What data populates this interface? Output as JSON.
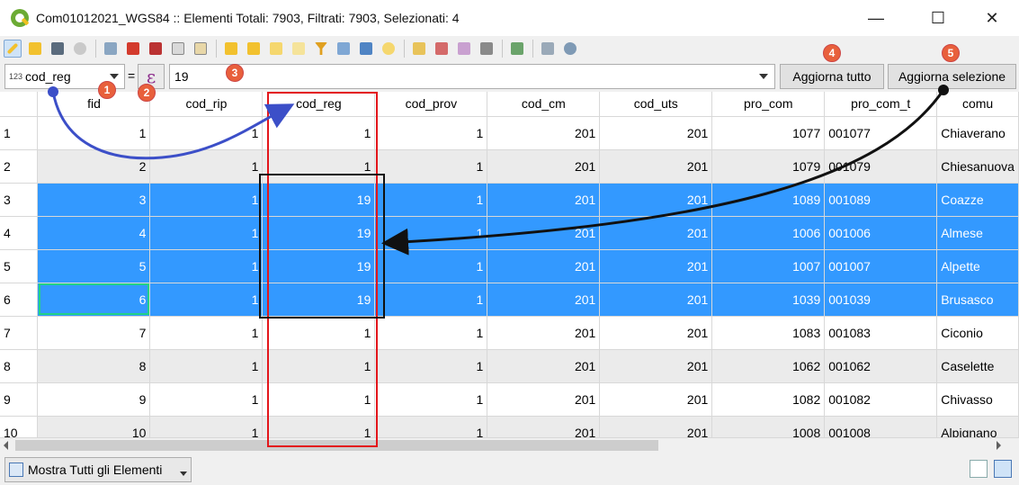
{
  "window": {
    "title": "Com01012021_WGS84 :: Elementi Totali: 7903, Filtrati: 7903, Selezionati: 4",
    "minimize": "—",
    "maximize": "☐",
    "close": "✕"
  },
  "filter": {
    "field_type": "123",
    "field": "cod_reg",
    "equals": "=",
    "expr_symbol": "ε",
    "value": "19",
    "update_all": "Aggiorna tutto",
    "update_selection": "Aggiorna selezione"
  },
  "columns": [
    "fid",
    "cod_rip",
    "cod_reg",
    "cod_prov",
    "cod_cm",
    "cod_uts",
    "pro_com",
    "pro_com_t",
    "comu"
  ],
  "rows": [
    {
      "n": "1",
      "fid": "1",
      "cod_rip": "1",
      "cod_reg": "1",
      "cod_prov": "1",
      "cod_cm": "201",
      "cod_uts": "201",
      "pro_com": "1077",
      "pro_com_t": "001077",
      "comu": "Chiaverano"
    },
    {
      "n": "2",
      "fid": "2",
      "cod_rip": "1",
      "cod_reg": "1",
      "cod_prov": "1",
      "cod_cm": "201",
      "cod_uts": "201",
      "pro_com": "1079",
      "pro_com_t": "001079",
      "comu": "Chiesanuova"
    },
    {
      "n": "3",
      "fid": "3",
      "cod_rip": "1",
      "cod_reg": "19",
      "cod_prov": "1",
      "cod_cm": "201",
      "cod_uts": "201",
      "pro_com": "1089",
      "pro_com_t": "001089",
      "comu": "Coazze"
    },
    {
      "n": "4",
      "fid": "4",
      "cod_rip": "1",
      "cod_reg": "19",
      "cod_prov": "1",
      "cod_cm": "201",
      "cod_uts": "201",
      "pro_com": "1006",
      "pro_com_t": "001006",
      "comu": "Almese"
    },
    {
      "n": "5",
      "fid": "5",
      "cod_rip": "1",
      "cod_reg": "19",
      "cod_prov": "1",
      "cod_cm": "201",
      "cod_uts": "201",
      "pro_com": "1007",
      "pro_com_t": "001007",
      "comu": "Alpette"
    },
    {
      "n": "6",
      "fid": "6",
      "cod_rip": "1",
      "cod_reg": "19",
      "cod_prov": "1",
      "cod_cm": "201",
      "cod_uts": "201",
      "pro_com": "1039",
      "pro_com_t": "001039",
      "comu": "Brusasco"
    },
    {
      "n": "7",
      "fid": "7",
      "cod_rip": "1",
      "cod_reg": "1",
      "cod_prov": "1",
      "cod_cm": "201",
      "cod_uts": "201",
      "pro_com": "1083",
      "pro_com_t": "001083",
      "comu": "Ciconio"
    },
    {
      "n": "8",
      "fid": "8",
      "cod_rip": "1",
      "cod_reg": "1",
      "cod_prov": "1",
      "cod_cm": "201",
      "cod_uts": "201",
      "pro_com": "1062",
      "pro_com_t": "001062",
      "comu": "Caselette"
    },
    {
      "n": "9",
      "fid": "9",
      "cod_rip": "1",
      "cod_reg": "1",
      "cod_prov": "1",
      "cod_cm": "201",
      "cod_uts": "201",
      "pro_com": "1082",
      "pro_com_t": "001082",
      "comu": "Chivasso"
    },
    {
      "n": "10",
      "fid": "10",
      "cod_rip": "1",
      "cod_reg": "1",
      "cod_prov": "1",
      "cod_cm": "201",
      "cod_uts": "201",
      "pro_com": "1008",
      "pro_com_t": "001008",
      "comu": "Alpignano"
    }
  ],
  "selected_rows": [
    "3",
    "4",
    "5",
    "6"
  ],
  "bottom": {
    "show_all": "Mostra Tutti gli Elementi"
  },
  "badges": [
    "1",
    "2",
    "3",
    "4",
    "5"
  ],
  "colors": {
    "selection": "#3399ff",
    "badge": "#e8603c",
    "blue_arrow": "#3c4fc8",
    "red_box": "#e3151a"
  }
}
